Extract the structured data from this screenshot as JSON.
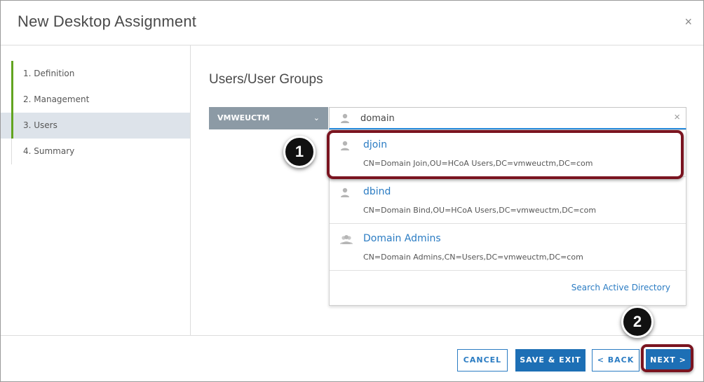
{
  "dialog": {
    "title": "New Desktop Assignment",
    "close_label": "×"
  },
  "steps": [
    {
      "label": "1. Definition",
      "state": "done"
    },
    {
      "label": "2. Management",
      "state": "done"
    },
    {
      "label": "3. Users",
      "state": "active"
    },
    {
      "label": "4. Summary",
      "state": "pending"
    }
  ],
  "main": {
    "section_title": "Users/User Groups",
    "domain_select": {
      "value": "VMWEUCTM",
      "chevron": "⌄"
    },
    "search": {
      "value": "domain",
      "clear_label": "×"
    },
    "results": [
      {
        "name": "djoin",
        "dn": "CN=Domain Join,OU=HCoA Users,DC=vmweuctm,DC=com",
        "icon": "user-icon"
      },
      {
        "name": "dbind",
        "dn": "CN=Domain Bind,OU=HCoA Users,DC=vmweuctm,DC=com",
        "icon": "user-icon"
      },
      {
        "name": "Domain Admins",
        "dn": "CN=Domain Admins,CN=Users,DC=vmweuctm,DC=com",
        "icon": "group-icon"
      }
    ],
    "search_ad_label": "Search Active Directory"
  },
  "footer": {
    "cancel_label": "CANCEL",
    "save_exit_label": "SAVE & EXIT",
    "back_label": "< BACK",
    "next_label": "NEXT >"
  },
  "callouts": [
    "1",
    "2"
  ],
  "colors": {
    "accent": "#2b7cc3",
    "primary_button": "#1d6fb5",
    "step_complete": "#62a420",
    "highlight": "#7a1420",
    "select_bg": "#8c9aa5"
  }
}
